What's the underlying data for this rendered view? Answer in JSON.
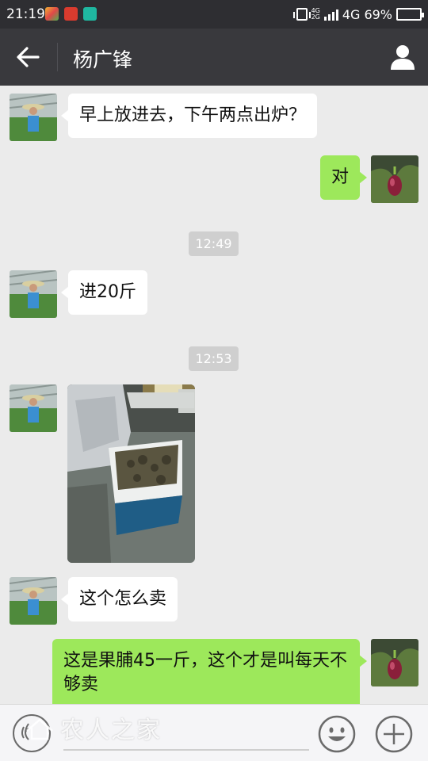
{
  "status_bar": {
    "time": "21:19",
    "network": "4G",
    "network_small_top": "4G",
    "network_small_bottom": "2G",
    "battery_percent": "69%",
    "battery_level": 0.69
  },
  "header": {
    "contact_name": "杨广锋",
    "back_icon": "arrow-left-icon",
    "profile_icon": "person-icon"
  },
  "messages": [
    {
      "side": "in",
      "type": "text",
      "text": "早上放进去，下午两点出炉？"
    },
    {
      "side": "out",
      "type": "text",
      "text": "对"
    },
    {
      "type": "timestamp",
      "text": "12:49"
    },
    {
      "side": "in",
      "type": "text",
      "text": "进20斤"
    },
    {
      "type": "timestamp",
      "text": "12:53"
    },
    {
      "side": "in",
      "type": "image"
    },
    {
      "side": "in",
      "type": "text",
      "text": "这个怎么卖"
    },
    {
      "side": "out",
      "type": "text",
      "text": "这是果脯45一斤，这个才是叫每天不够卖"
    }
  ],
  "input_bar": {
    "voice_icon": "voice-icon",
    "emoji_icon": "smiley-icon",
    "plus_icon": "plus-icon",
    "watermark": "农人之家"
  },
  "colors": {
    "header_bg": "#39393d",
    "chat_bg": "#ebebeb",
    "outgoing_bubble": "#9de85b",
    "incoming_bubble": "#ffffff"
  }
}
